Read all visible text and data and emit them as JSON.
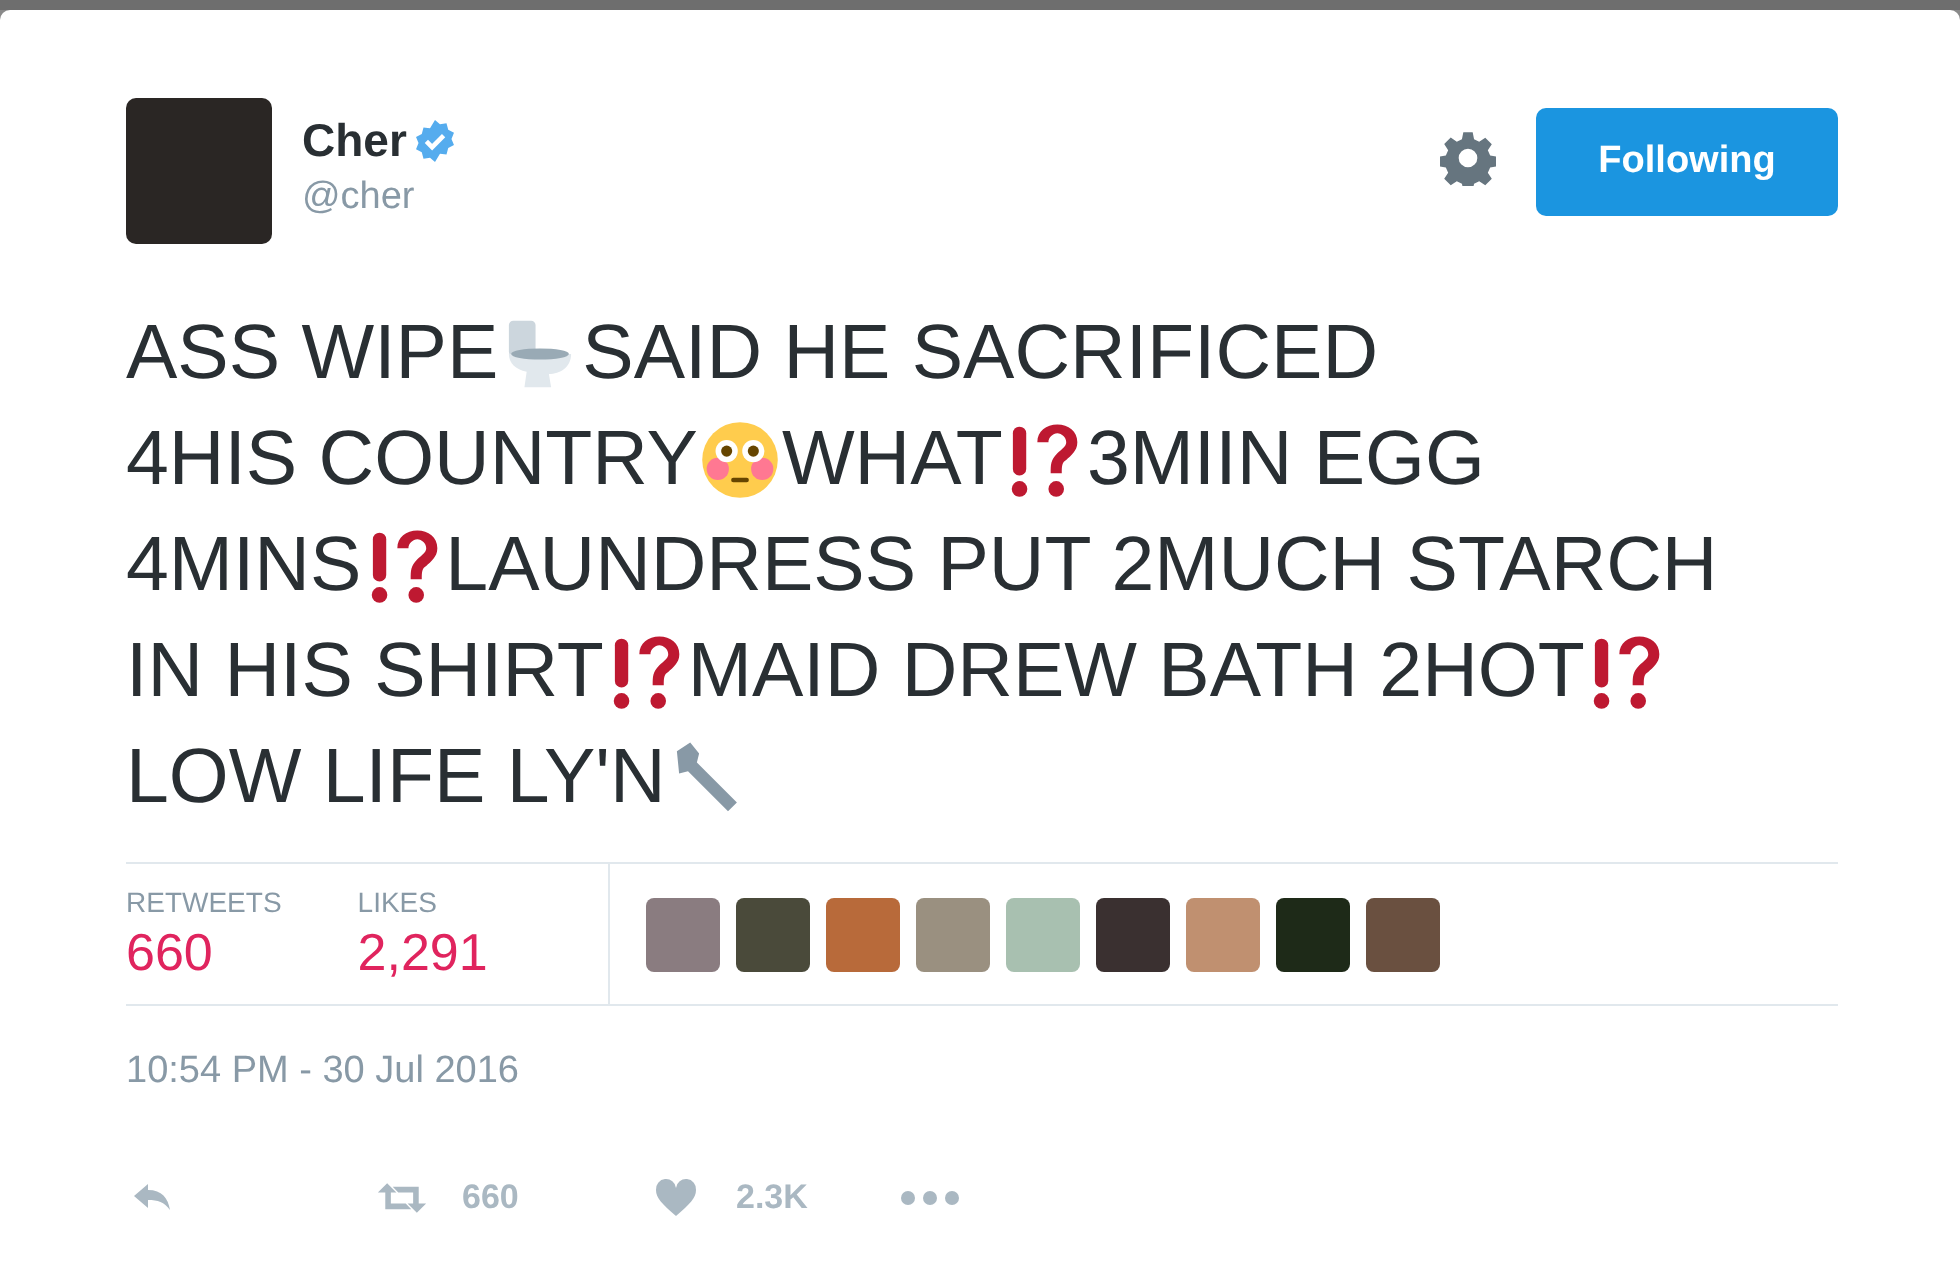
{
  "tweet": {
    "name": "Cher",
    "verified": true,
    "handle": "@cher",
    "follow_button": "Following",
    "text": [
      [
        {
          "kind": "text",
          "text": "ASS WIPE"
        },
        {
          "kind": "toilet"
        },
        {
          "kind": "text",
          "text": "SAID HE SACRIFICED"
        }
      ],
      [
        {
          "kind": "text",
          "text": "4HIS COUNTRY"
        },
        {
          "kind": "flushed"
        },
        {
          "kind": "text",
          "text": "WHAT"
        },
        {
          "kind": "interrobang"
        },
        {
          "kind": "text",
          "text": "3MIIN EGG"
        }
      ],
      [
        {
          "kind": "text",
          "text": "4MINS"
        },
        {
          "kind": "interrobang"
        },
        {
          "kind": "text",
          "text": "LAUNDRESS PUT 2MUCH STARCH"
        }
      ],
      [
        {
          "kind": "text",
          "text": "IN HIS SHIRT"
        },
        {
          "kind": "interrobang"
        },
        {
          "kind": "text",
          "text": "MAID DREW BATH 2HOT"
        },
        {
          "kind": "interrobang"
        }
      ],
      [
        {
          "kind": "text",
          "text": "LOW LIFE LY'N"
        },
        {
          "kind": "wrench"
        }
      ]
    ],
    "stats": [
      {
        "label": "RETWEETS",
        "value": "660"
      },
      {
        "label": "LIKES",
        "value": "2,291"
      }
    ],
    "timestamp": "10:54 PM - 30 Jul 2016",
    "actions": [
      {
        "kind": "reply"
      },
      {
        "kind": "retweet",
        "count": "660"
      },
      {
        "kind": "like",
        "count": "2.3K"
      },
      {
        "kind": "more"
      }
    ]
  }
}
